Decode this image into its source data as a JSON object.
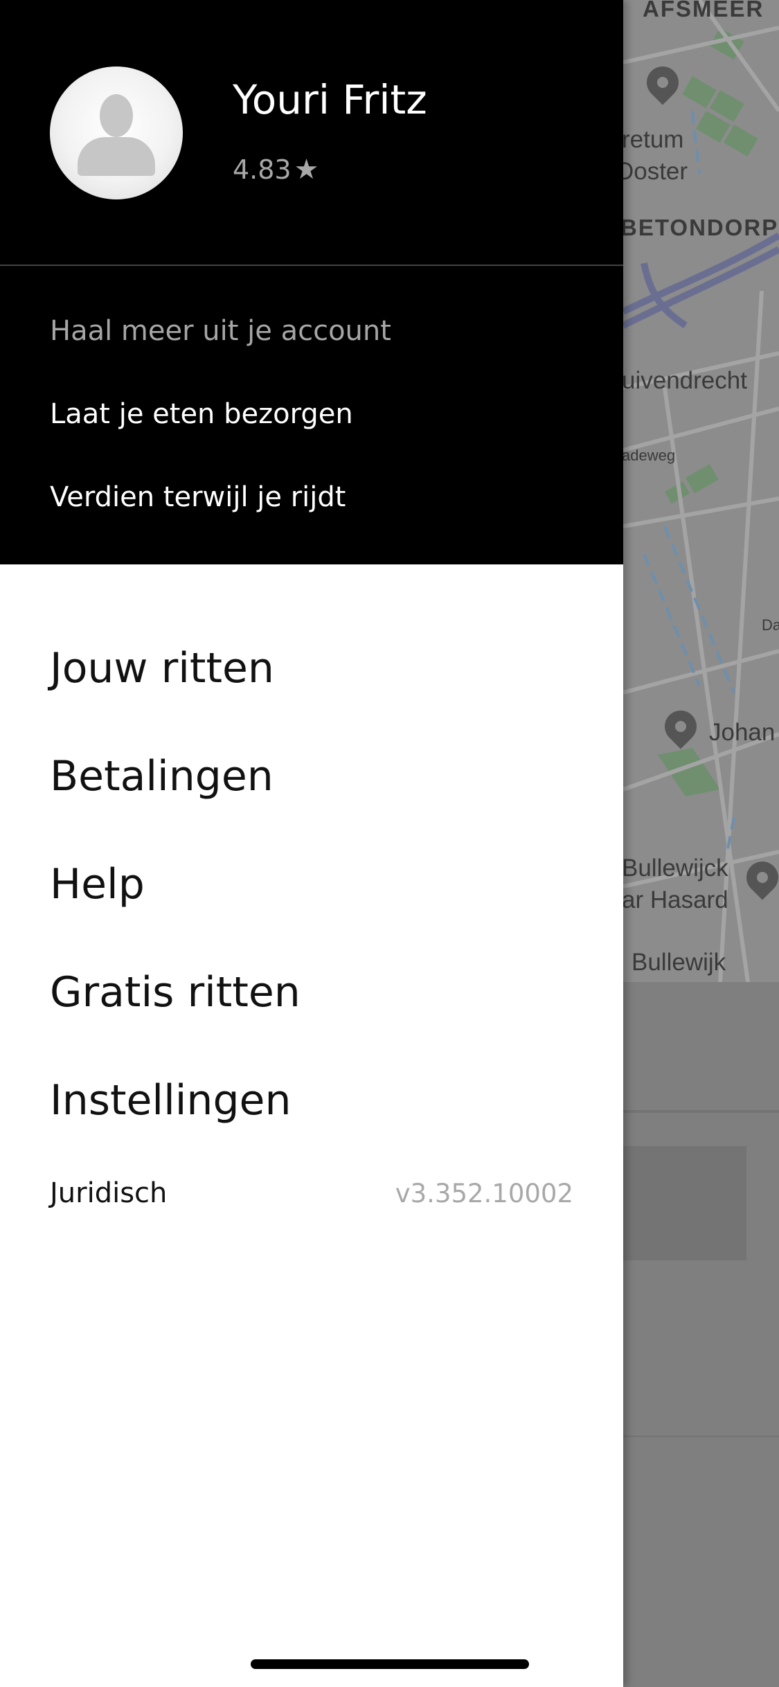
{
  "user": {
    "name": "Youri Fritz",
    "rating": "4.83",
    "rating_icon": "star-icon"
  },
  "header_links": {
    "account": "Haal meer uit je account",
    "eats": "Laat je eten bezorgen",
    "drive": "Verdien terwijl je rijdt"
  },
  "menu": {
    "trips": "Jouw ritten",
    "payments": "Betalingen",
    "help": "Help",
    "free_rides": "Gratis ritten",
    "settings": "Instellingen"
  },
  "footer": {
    "legal": "Juridisch",
    "version": "v3.352.10002"
  },
  "map": {
    "labels": {
      "watergraafsmeer": "AFSMEER",
      "arboretum_1": "retum",
      "arboretum_2": "Ooster",
      "betondorp": "BETONDORP",
      "duivendrecht": "uivendrecht",
      "road": "adeweg",
      "johan": "Johan",
      "bullewijck_1": "Bullewijck",
      "bullewijck_2": "ar Hasard",
      "bullewijk": "Bullewijk",
      "edge": "Da"
    }
  },
  "colors": {
    "drawer_header": "#000000",
    "drawer_body": "#ffffff",
    "muted_text": "#a6a6a6",
    "map_dim": "#8c8c8c"
  }
}
